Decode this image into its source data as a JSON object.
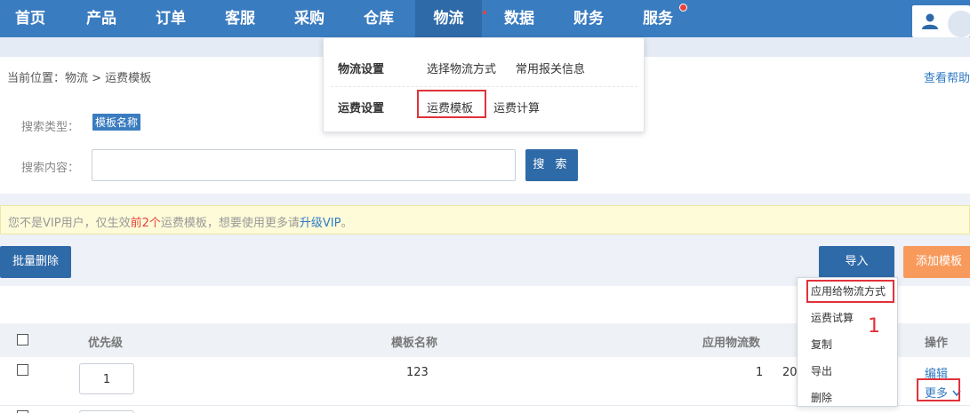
{
  "nav": {
    "items": [
      "首页",
      "产品",
      "订单",
      "客服",
      "采购",
      "仓库",
      "物流",
      "数据",
      "财务",
      "服务"
    ],
    "active": "物流"
  },
  "breadcrumb": {
    "prefix": "当前位置：物流 >",
    "current": "运费模板"
  },
  "help_link": "查看帮助",
  "search": {
    "type_label": "搜索类型：",
    "type_value": "模板名称",
    "content_label": "搜索内容：",
    "input_value": "",
    "button": "搜 索"
  },
  "vip_notice": {
    "part1": "您不是VIP用户，仅生效",
    "highlight": "前2个",
    "part2": "运费模板，想要使用更多请",
    "link": "升级VIP",
    "end": "。"
  },
  "actions": {
    "batch_delete": "批量删除",
    "import": "导入",
    "add": "添加模板"
  },
  "table": {
    "headers": [
      "优先级",
      "模板名称",
      "应用物流数",
      "操作"
    ],
    "rows": [
      {
        "priority": "1",
        "name": "123",
        "count": "1",
        "truncated": "20",
        "edit": "编辑",
        "more": "更多"
      }
    ]
  },
  "logistics_menu": {
    "groups": [
      {
        "title": "物流设置",
        "items": [
          "选择物流方式",
          "常用报关信息"
        ]
      },
      {
        "title": "运费设置",
        "items": [
          "运费模板",
          "运费计算"
        ]
      }
    ]
  },
  "more_menu": {
    "items": [
      "应用给物流方式",
      "运费试算",
      "复制",
      "导出",
      "删除"
    ]
  },
  "annotation": "1",
  "colors": {
    "nav": "#3a7cc0",
    "primary": "#2f6aa8",
    "accent": "#f79a5c",
    "highlight": "#e0323a"
  }
}
